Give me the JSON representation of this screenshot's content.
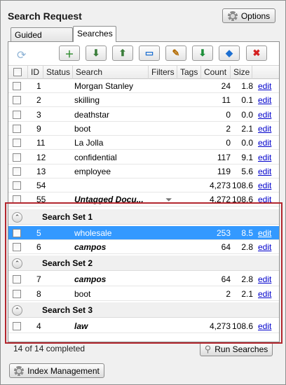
{
  "header": {
    "title": "Search Request",
    "options_label": "Options"
  },
  "tabs": [
    {
      "label": "Guided Search"
    },
    {
      "label": "Searches"
    }
  ],
  "toolbar": {
    "refresh_icon": "⟳",
    "buttons": [
      {
        "name": "new-search-icon",
        "glyph": "＋",
        "color": "#2e8b2e"
      },
      {
        "name": "import-icon",
        "glyph": "⬇",
        "color": "#3a7d3a"
      },
      {
        "name": "export-icon",
        "glyph": "⬆",
        "color": "#3a7d3a"
      },
      {
        "name": "folder-icon",
        "glyph": "▭",
        "color": "#1d6fd1"
      },
      {
        "name": "edit-icon",
        "glyph": "✎",
        "color": "#b36b00"
      },
      {
        "name": "download-icon",
        "glyph": "⬇",
        "color": "#1d8f3a"
      },
      {
        "name": "tag-icon",
        "glyph": "◆",
        "color": "#1d6fd1"
      },
      {
        "name": "delete-icon",
        "glyph": "✖",
        "color": "#d42020"
      }
    ]
  },
  "columns": {
    "id": "ID",
    "status": "Status",
    "search": "Search",
    "filters": "Filters",
    "tags": "Tags",
    "count": "Count",
    "size": "Size"
  },
  "rows": [
    {
      "id": "1",
      "search": "Morgan Stanley",
      "count": "24",
      "size": "1.8",
      "edit": "edit",
      "italic": false
    },
    {
      "id": "2",
      "search": "skilling",
      "count": "11",
      "size": "0.1",
      "edit": "edit",
      "italic": false
    },
    {
      "id": "3",
      "search": "deathstar",
      "count": "0",
      "size": "0.0",
      "edit": "edit",
      "italic": false
    },
    {
      "id": "9",
      "search": "boot",
      "count": "2",
      "size": "2.1",
      "edit": "edit",
      "italic": false
    },
    {
      "id": "11",
      "search": "La Jolla",
      "count": "0",
      "size": "0.0",
      "edit": "edit",
      "italic": false
    },
    {
      "id": "12",
      "search": "confidential",
      "count": "117",
      "size": "9.1",
      "edit": "edit",
      "italic": false
    },
    {
      "id": "13",
      "search": "employee",
      "count": "119",
      "size": "5.6",
      "edit": "edit",
      "italic": false
    },
    {
      "id": "54",
      "search": "",
      "count": "4,273",
      "size": "108.6",
      "edit": "edit",
      "italic": false
    },
    {
      "id": "55",
      "search": "Untagged Docu...",
      "count": "4,272",
      "size": "108.6",
      "edit": "edit",
      "italic": true,
      "filter": true
    }
  ],
  "groups": [
    {
      "label": "Search Set 1",
      "rows": [
        {
          "id": "5",
          "search": "wholesale",
          "count": "253",
          "size": "8.5",
          "edit": "edit",
          "italic": false,
          "selected": true
        },
        {
          "id": "6",
          "search": "campos",
          "count": "64",
          "size": "2.8",
          "edit": "edit",
          "italic": true
        }
      ]
    },
    {
      "label": "Search Set 2",
      "rows": [
        {
          "id": "7",
          "search": "campos",
          "count": "64",
          "size": "2.8",
          "edit": "edit",
          "italic": true
        },
        {
          "id": "8",
          "search": "boot",
          "count": "2",
          "size": "2.1",
          "edit": "edit",
          "italic": false
        }
      ]
    },
    {
      "label": "Search Set 3",
      "rows": [
        {
          "id": "4",
          "search": "law",
          "count": "4,273",
          "size": "108.6",
          "edit": "edit",
          "italic": true
        }
      ]
    }
  ],
  "footer": {
    "status": "14 of 14 completed",
    "run_label": "Run Searches",
    "index_label": "Index Management"
  },
  "colors": {
    "selection": "#3399ff",
    "highlight_box": "#b3262e",
    "link": "#0000cc"
  }
}
